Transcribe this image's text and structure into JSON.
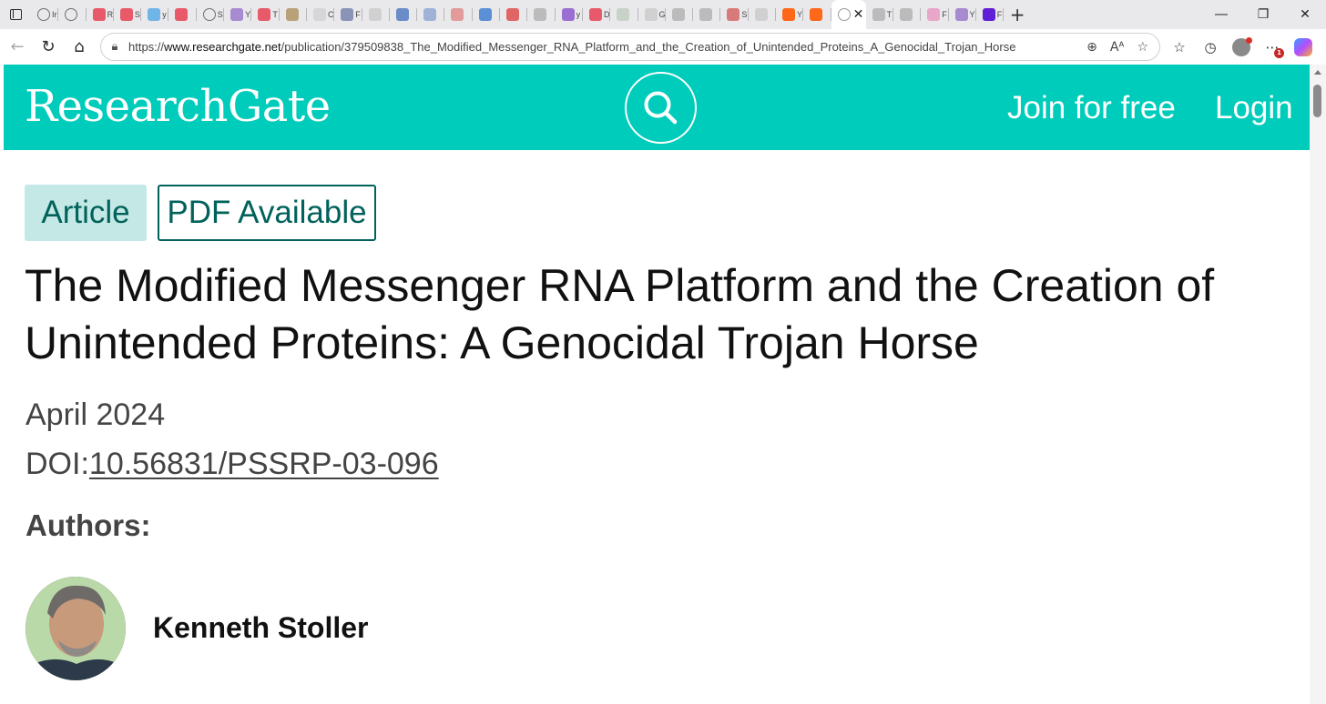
{
  "browser": {
    "mini_tabs": [
      {
        "icon": "globe-icon",
        "letter": "Ir",
        "color": ""
      },
      {
        "icon": "globe-icon",
        "letter": "",
        "color": ""
      },
      {
        "icon": "youtube-icon",
        "letter": "R",
        "color": "#e85a6a"
      },
      {
        "icon": "youtube-icon",
        "letter": "S",
        "color": "#e85a6a"
      },
      {
        "icon": "bing-icon",
        "letter": "y",
        "color": "#6fb5e8"
      },
      {
        "icon": "youtube-icon",
        "letter": "",
        "color": "#e85a6a"
      },
      {
        "icon": "globe-icon",
        "letter": "S",
        "color": ""
      },
      {
        "icon": "slash-icon",
        "letter": "Y",
        "color": "#a78ad0"
      },
      {
        "icon": "youtube-icon",
        "letter": "T",
        "color": "#e85a6a"
      },
      {
        "icon": "image-icon",
        "letter": "",
        "color": "#b9a27a"
      },
      {
        "icon": "doc-icon",
        "letter": "C",
        "color": "#d6d6d6"
      },
      {
        "icon": "shield-icon",
        "letter": "F",
        "color": "#8a93b8"
      },
      {
        "icon": "google-icon",
        "letter": "",
        "color": "#d0d0d0"
      },
      {
        "icon": "m-icon",
        "letter": "",
        "color": "#6a8cc8"
      },
      {
        "icon": "search-icon",
        "letter": "",
        "color": "#9fb3d6"
      },
      {
        "icon": "r-icon",
        "letter": "",
        "color": "#e29a9a"
      },
      {
        "icon": "circle-icon",
        "letter": "",
        "color": "#5b8fd6"
      },
      {
        "icon": "pdf-icon",
        "letter": "",
        "color": "#e06666"
      },
      {
        "icon": "otn-icon",
        "letter": "",
        "color": "#bbbbbb"
      },
      {
        "icon": "yahoo-icon",
        "letter": "y",
        "color": "#9a6fd1"
      },
      {
        "icon": "youtube-icon",
        "letter": "D",
        "color": "#e85a6a"
      },
      {
        "icon": "mosaic-icon",
        "letter": "",
        "color": "#c8d2c8"
      },
      {
        "icon": "google-icon",
        "letter": "G",
        "color": "#d0d0d0"
      },
      {
        "icon": "font-icon",
        "letter": "",
        "color": "#bbbbbb"
      },
      {
        "icon": "font-icon",
        "letter": "",
        "color": "#bbbbbb"
      },
      {
        "icon": "grid-icon",
        "letter": "S",
        "color": "#d97a7a"
      },
      {
        "icon": "needle-icon",
        "letter": "",
        "color": "#d0d0d0"
      },
      {
        "icon": "substack-icon",
        "letter": "Y",
        "color": "#ff6719"
      },
      {
        "icon": "substack-icon",
        "letter": "",
        "color": "#ff6719"
      }
    ],
    "active_tab_close": "✕",
    "after_tabs": [
      {
        "icon": "gp-icon",
        "letter": "T",
        "color": "#bbbbbb"
      },
      {
        "icon": "fp-icon",
        "letter": "",
        "color": "#bbbbbb"
      },
      {
        "icon": "cap-icon",
        "letter": "F",
        "color": "#e8a6c8"
      },
      {
        "icon": "slash-icon",
        "letter": "Y",
        "color": "#a78ad0"
      },
      {
        "icon": "yahoo-icon",
        "letter": "F",
        "color": "#5f1fd6"
      }
    ],
    "new_tab": "+",
    "url_prefix": "https://",
    "url_host": "www.researchgate.net",
    "url_path": "/publication/379509838_The_Modified_Messenger_RNA_Platform_and_the_Creation_of_Unintended_Proteins_A_Genocidal_Trojan_Horse",
    "notification_count": "1"
  },
  "header": {
    "logo": "ResearchGate",
    "join_label": "Join for free",
    "login_label": "Login",
    "brand_color": "#00ccbb"
  },
  "article": {
    "type_label": "Article",
    "pdf_label": "PDF Available",
    "title": "The Modified Messenger RNA Platform and the Creation of Unintended Proteins: A Genocidal Trojan Horse",
    "date": "April 2024",
    "doi_prefix": "DOI:",
    "doi": "10.56831/PSSRP-03-096",
    "authors_heading": "Authors:",
    "authors": [
      {
        "name": "Kenneth Stoller"
      }
    ]
  }
}
